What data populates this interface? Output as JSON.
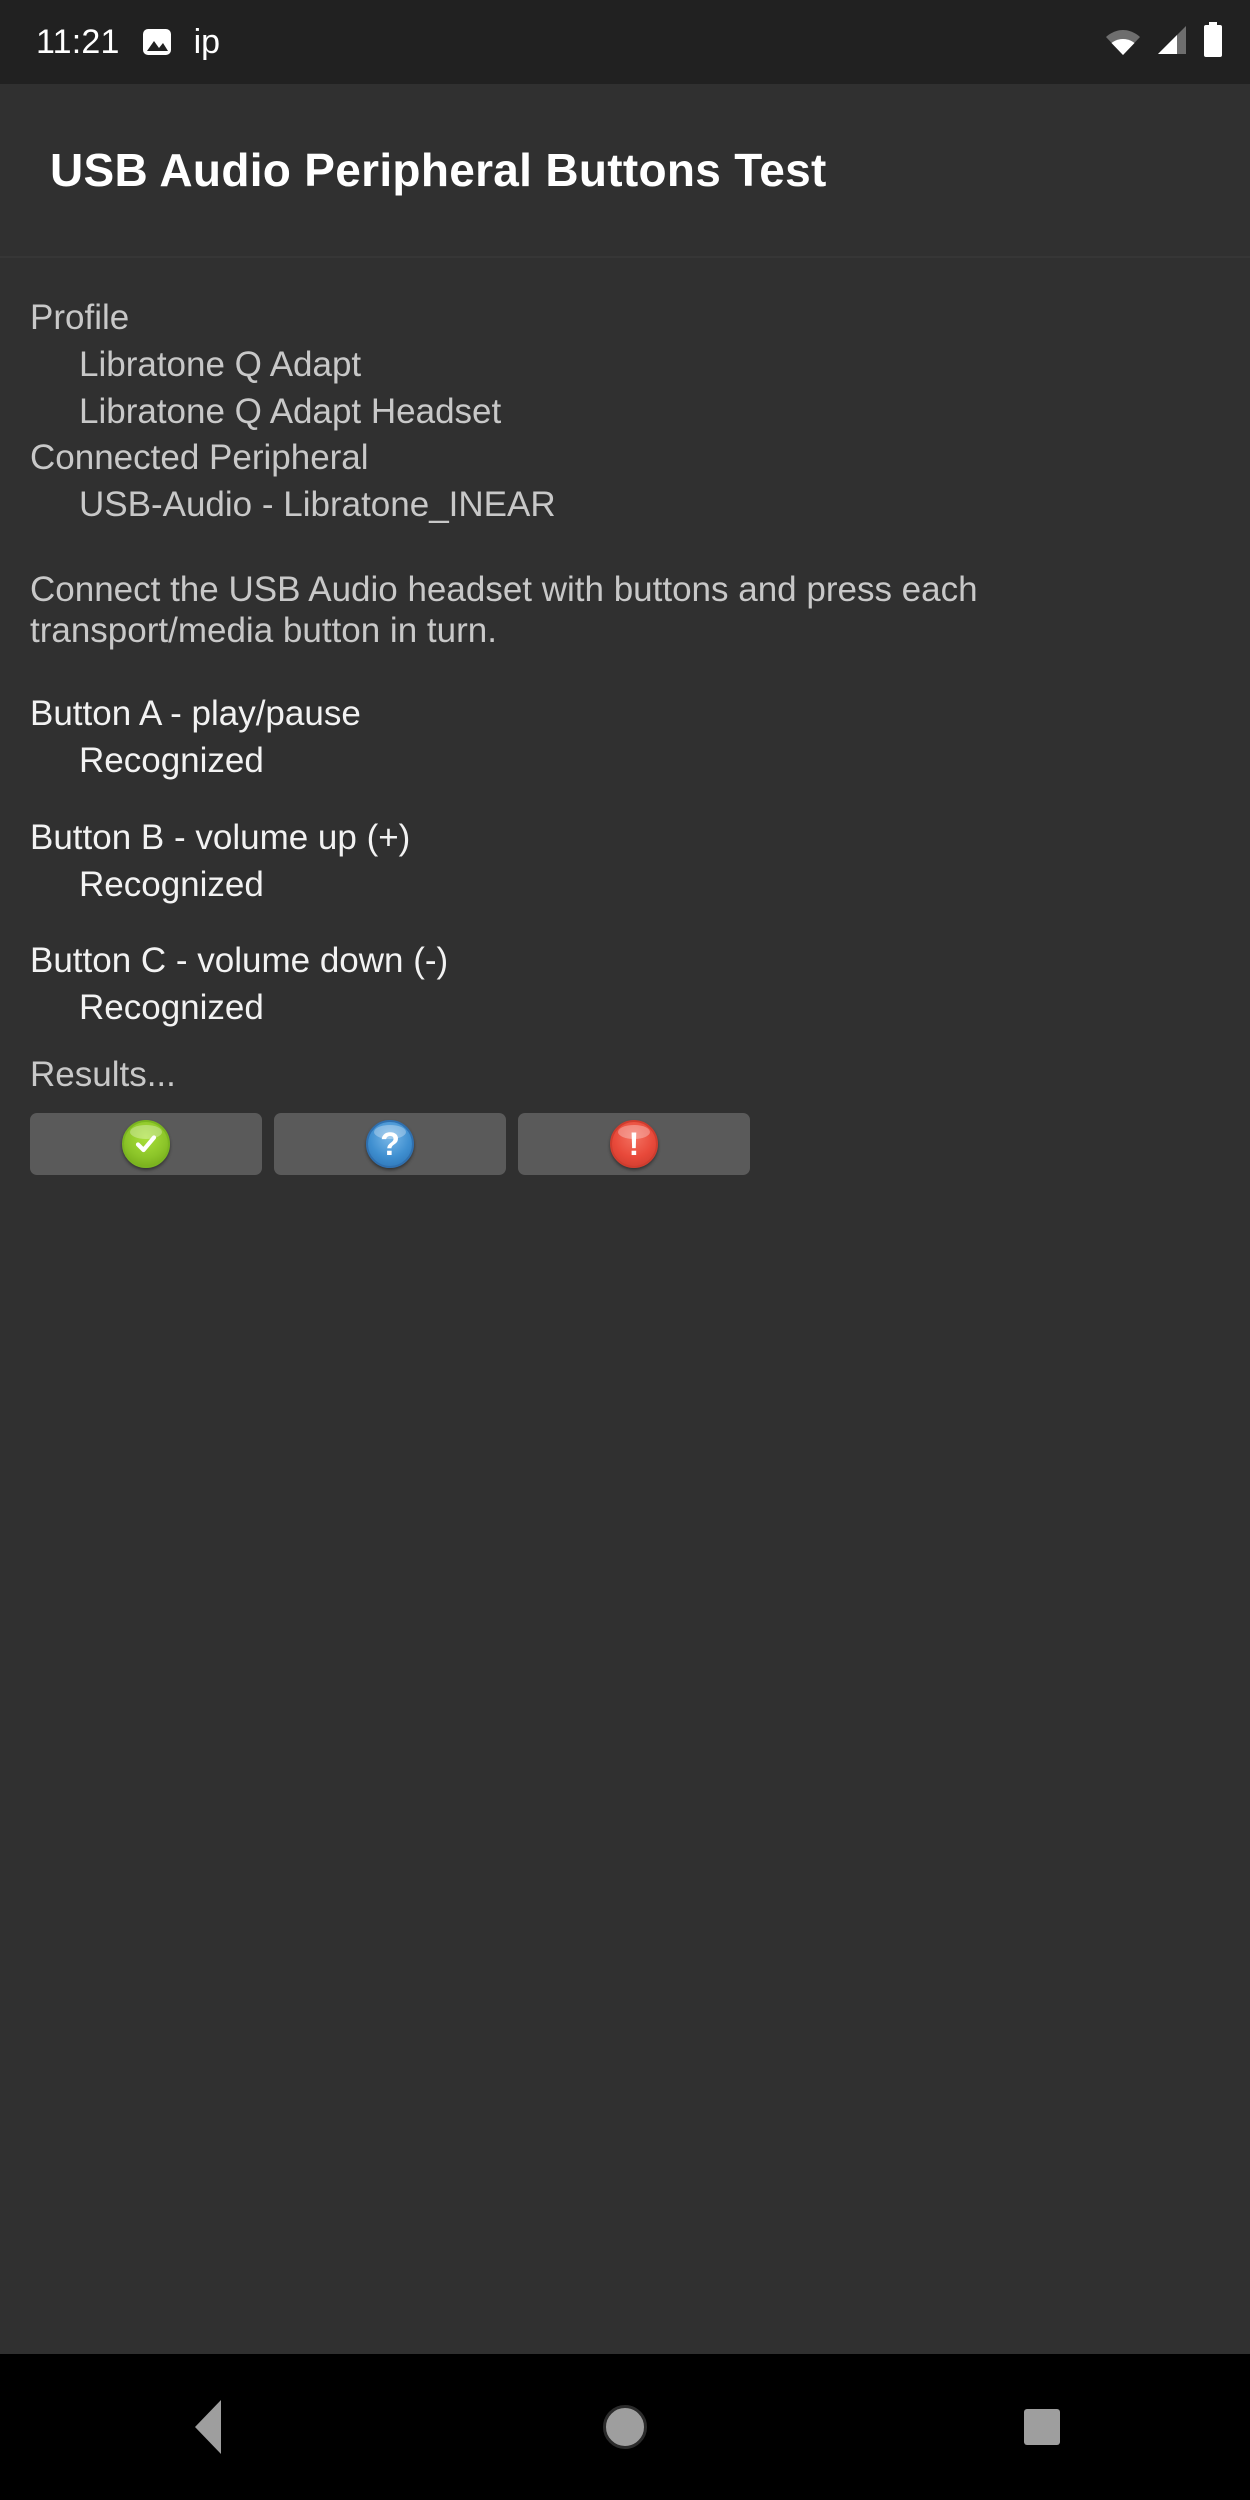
{
  "status_bar": {
    "clock": "11:21",
    "notification_icon": "photo-icon",
    "notification_label": "ip",
    "wifi_icon": "wifi-icon",
    "signal_icon": "cell-signal-icon",
    "battery_icon": "battery-icon"
  },
  "title_bar": {
    "title": "USB Audio Peripheral Buttons Test"
  },
  "content": {
    "profile_label": "Profile",
    "profile_values": [
      "Libratone Q Adapt",
      "Libratone Q Adapt Headset"
    ],
    "connected_label": "Connected Peripheral",
    "connected_value": "USB-Audio - Libratone_INEAR",
    "instructions": "Connect the USB Audio headset with buttons and press each transport/media button in turn.",
    "buttons": [
      {
        "name": "Button A - play/pause",
        "status": "Recognized"
      },
      {
        "name": "Button B - volume up (+)",
        "status": "Recognized"
      },
      {
        "name": "Button C - volume down (-)",
        "status": "Recognized"
      }
    ],
    "results_label": "Results...",
    "result_buttons": [
      {
        "icon": "check-circle-icon",
        "color": "#8cc529"
      },
      {
        "icon": "question-circle-icon",
        "color": "#3f8fd0"
      },
      {
        "icon": "error-circle-icon",
        "color": "#e8493a"
      }
    ]
  },
  "nav_bar": {
    "back_icon": "back-triangle-icon",
    "home_icon": "home-circle-icon",
    "recents_icon": "recents-square-icon"
  }
}
